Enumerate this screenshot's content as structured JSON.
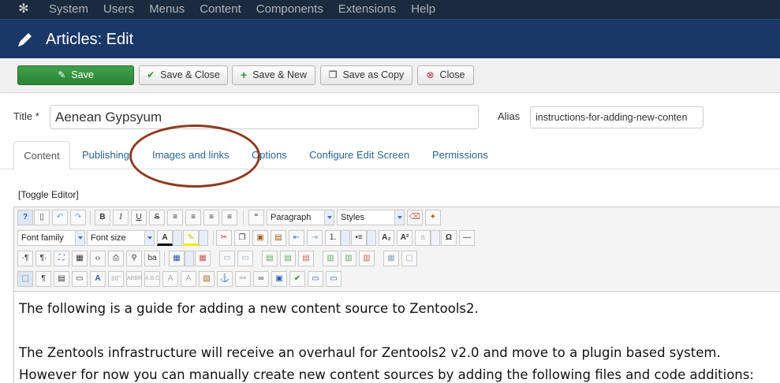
{
  "topbar": {
    "logo_icon": "joomla-logo",
    "menu": [
      "System",
      "Users",
      "Menus",
      "Content",
      "Components",
      "Extensions",
      "Help"
    ]
  },
  "header": {
    "title": "Articles: Edit",
    "icon": "pencil-icon"
  },
  "toolbar": {
    "save": "Save",
    "save_close": "Save & Close",
    "save_new": "Save & New",
    "save_copy": "Save as Copy",
    "close": "Close"
  },
  "form": {
    "title_label": "Title *",
    "title_value": "Aenean Gypsyum",
    "alias_label": "Alias",
    "alias_value": "instructions-for-adding-new-conten"
  },
  "tabs": [
    "Content",
    "Publishing",
    "Images and links",
    "Options",
    "Configure Edit Screen",
    "Permissions"
  ],
  "editor": {
    "toggle": "[Toggle Editor]",
    "format_select": "Paragraph",
    "styles_select": "Styles",
    "font_family": "Font family",
    "font_size": "Font size",
    "body": [
      "The following is a guide for adding a new content source to Zentools2.",
      "The Zentools infrastructure will receive an overhaul for Zentools2 v2.0 and move to a plugin based system.",
      "However for now you can manually create new content sources by adding the following files and code additions:"
    ]
  },
  "colors": {
    "topbar": "#1b2a3d",
    "titlebar": "#1a3867",
    "save_green": "#2f8f3a",
    "link_blue": "#2a6496",
    "annotation_circle": "#8d3a1e"
  }
}
